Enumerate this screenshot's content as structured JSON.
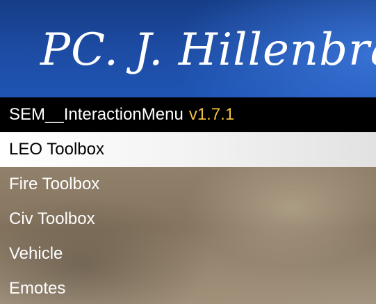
{
  "banner": {
    "title": "PC. J. Hillenbran"
  },
  "menu": {
    "name": "SEM__InteractionMenu",
    "version": "v1.7.1",
    "items": [
      {
        "label": "LEO Toolbox",
        "selected": true
      },
      {
        "label": "Fire Toolbox",
        "selected": false
      },
      {
        "label": "Civ Toolbox",
        "selected": false
      },
      {
        "label": "Vehicle",
        "selected": false
      },
      {
        "label": "Emotes",
        "selected": false
      }
    ]
  },
  "colors": {
    "banner": "#1c4aa0",
    "header_background": "#000000",
    "version_text": "#f0c043",
    "selected_background": "#ffffff",
    "selected_text": "#000000",
    "item_text": "#ffffff"
  }
}
